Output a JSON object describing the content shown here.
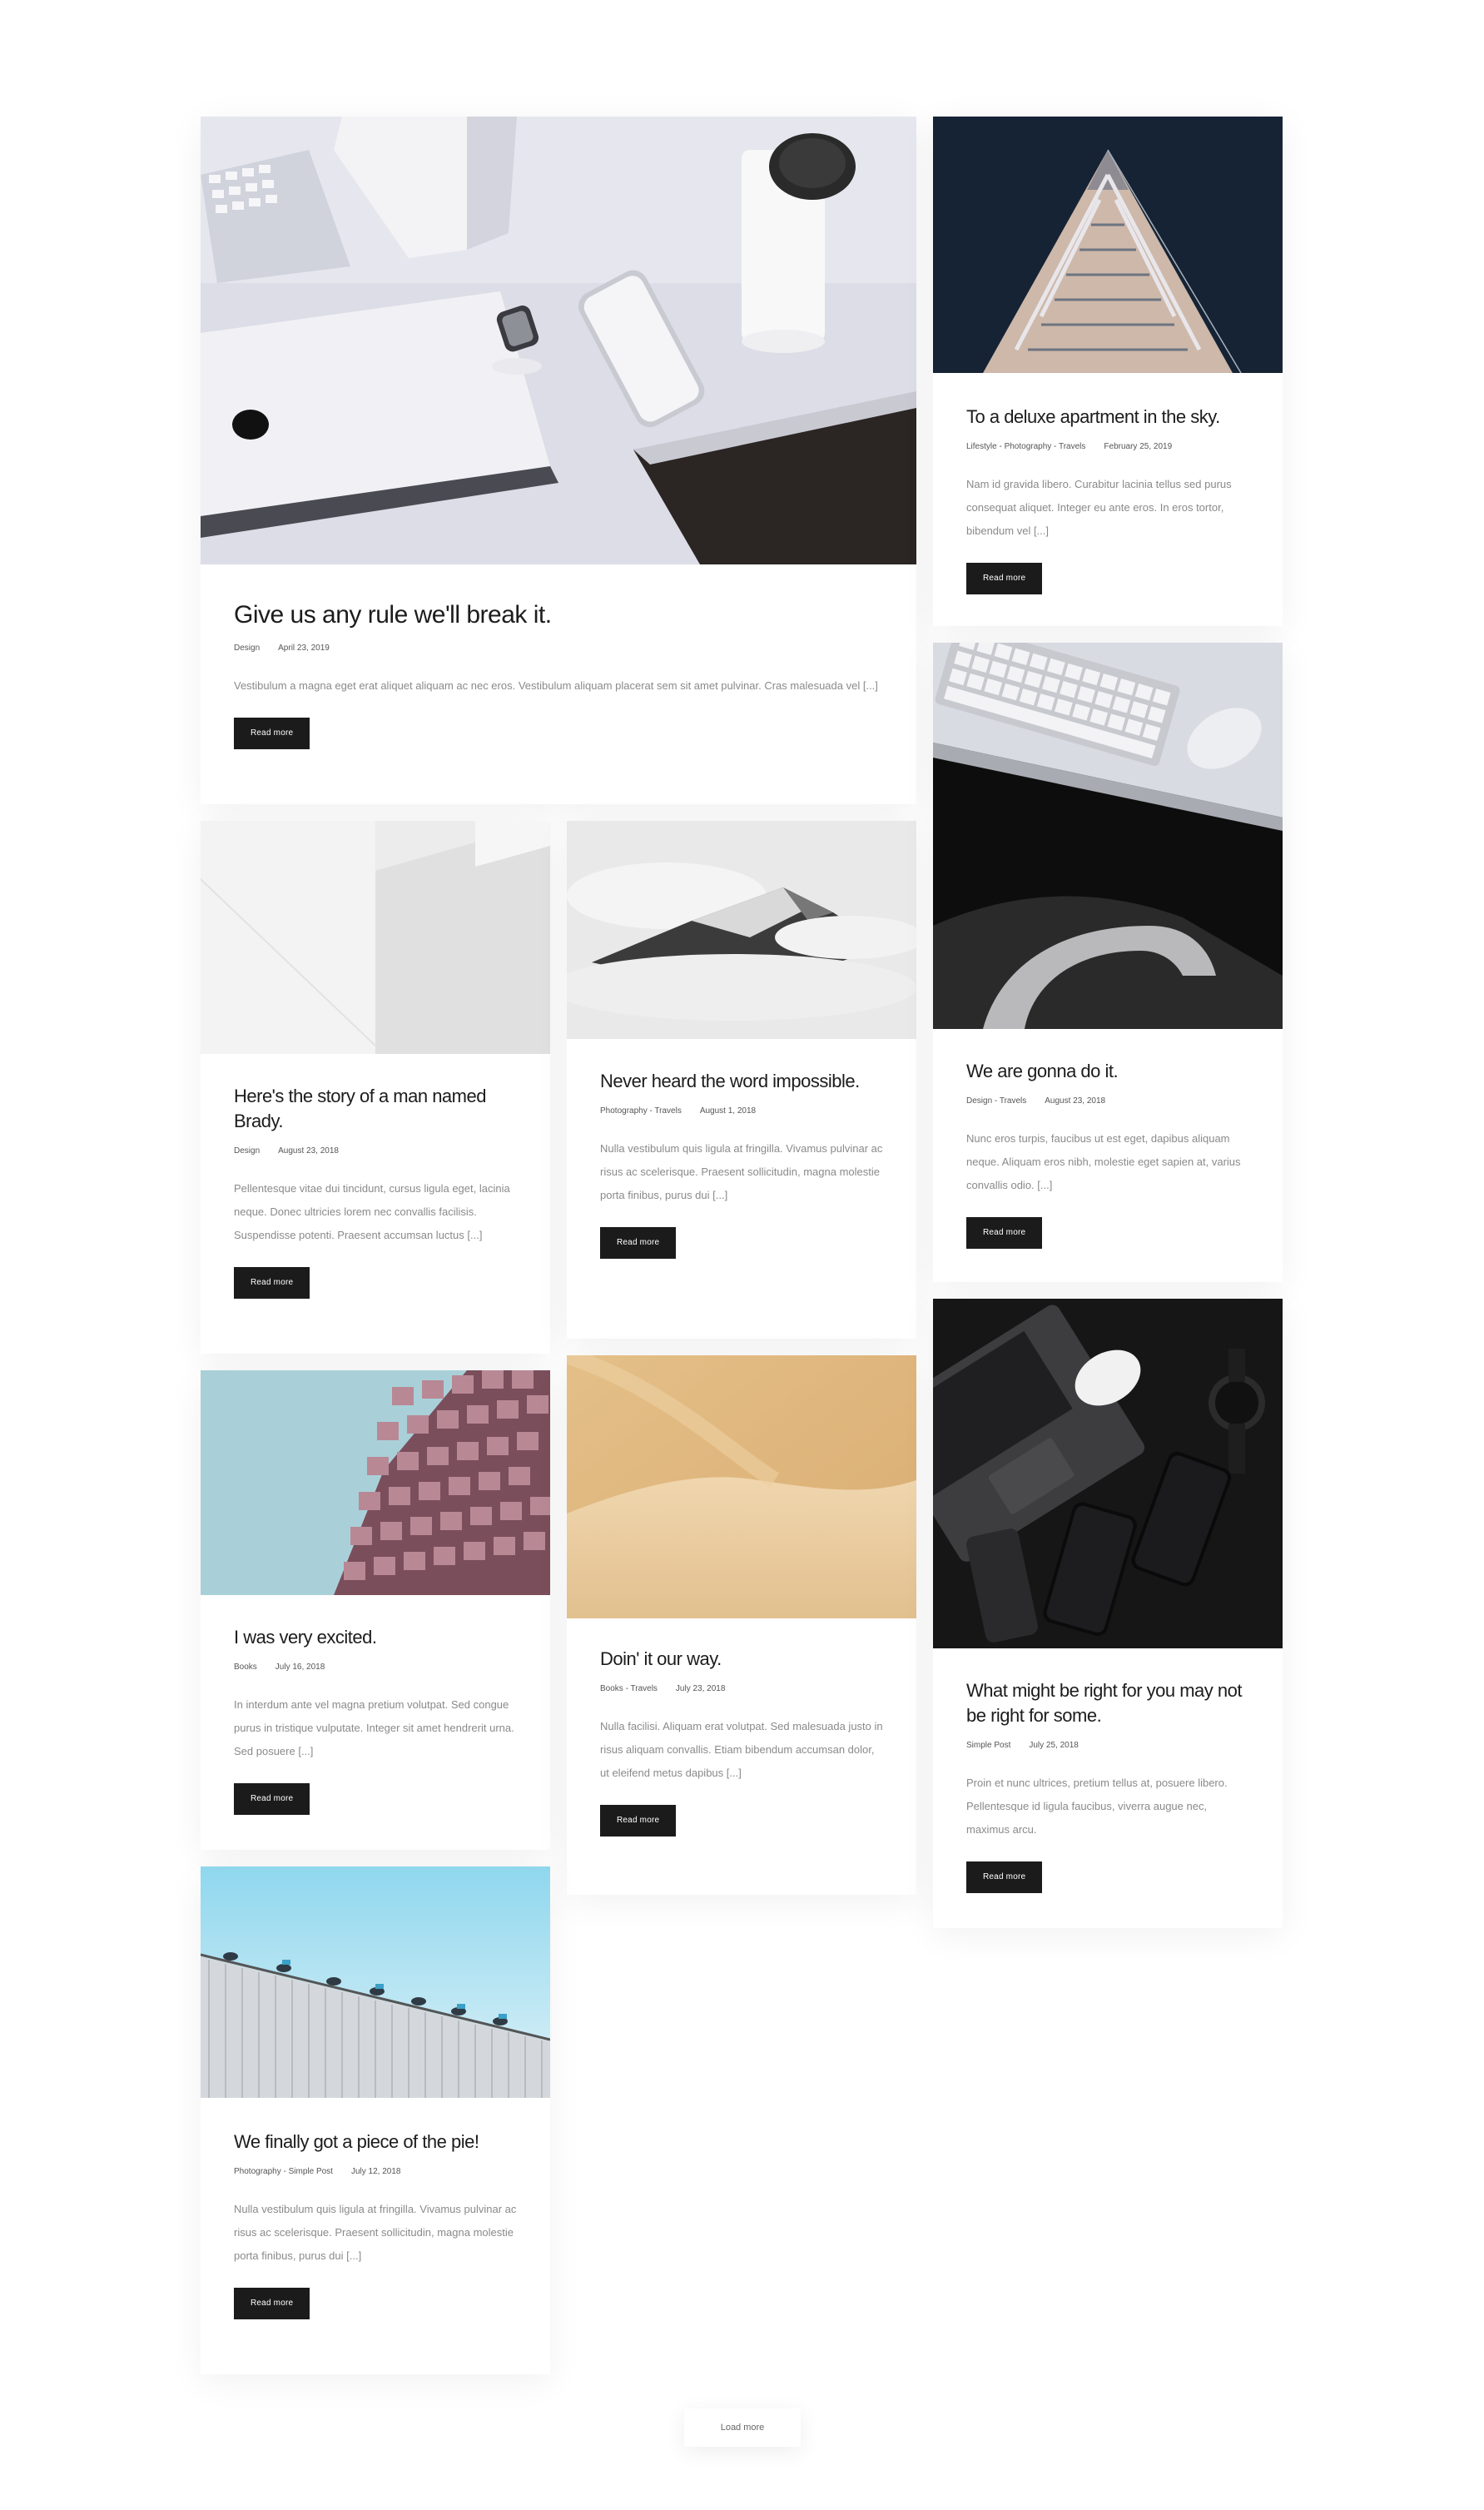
{
  "posts": [
    {
      "title": "Give us any rule we'll break it.",
      "categories": "Design",
      "date": "April 23, 2019",
      "excerpt": "Vestibulum a magna eget erat aliquet aliquam ac nec eros. Vestibulum aliquam placerat sem sit amet pulvinar. Cras malesuada vel [...]",
      "button": "Read more",
      "image": "desk-with-phone-watch-coffee"
    },
    {
      "title": "To a deluxe apartment in the sky.",
      "categories": "Lifestyle - Photography - Travels",
      "date": "February 25, 2019",
      "excerpt": "Nam id gravida libero. Curabitur lacinia tellus sed purus consequat aliquet. Integer eu ante eros. In eros tortor, bibendum vel [...]",
      "button": "Read more",
      "image": "skyscraper-corner-night"
    },
    {
      "title": "Here's the story of a man named Brady.",
      "categories": "Design",
      "date": "August 23, 2018",
      "excerpt": "Pellentesque vitae dui tincidunt, cursus ligula eget, lacinia neque. Donec ultricies lorem nec convallis facilisis. Suspendisse potenti. Praesent accumsan luctus [...]",
      "button": "Read more",
      "image": "white-architecture"
    },
    {
      "title": "Never heard the word impossible.",
      "categories": "Photography - Travels",
      "date": "August 1, 2018",
      "excerpt": "Nulla vestibulum quis ligula at fringilla. Vivamus pulvinar ac risus ac scelerisque. Praesent sollicitudin, magna molestie porta finibus, purus dui [...]",
      "button": "Read more",
      "image": "misty-mountain"
    },
    {
      "title": "We are gonna do it.",
      "categories": "Design - Travels",
      "date": "August 23, 2018",
      "excerpt": "Nunc eros turpis, faucibus ut est eget, dapibus aliquam neque. Aliquam eros nibh, molestie eget sapien at, varius convallis odio. [...]",
      "button": "Read more",
      "image": "keyboard-mouse-desk"
    },
    {
      "title": "I was very excited.",
      "categories": "Books",
      "date": "July 16, 2018",
      "excerpt": "In interdum ante vel magna pretium volutpat. Sed congue purus in tristique vulputate. Integer sit amet hendrerit urna. Sed posuere [...]",
      "button": "Read more",
      "image": "pink-building-facade"
    },
    {
      "title": "Doin' it our way.",
      "categories": "Books - Travels",
      "date": "July 23, 2018",
      "excerpt": "Nulla facilisi. Aliquam erat volutpat. Sed malesuada justo in risus aliquam convallis. Etiam bibendum accumsan dolor, ut eleifend metus dapibus [...]",
      "button": "Read more",
      "image": "sand-dune"
    },
    {
      "title": "What might be right for you may not be right for some.",
      "categories": "Simple Post",
      "date": "July 25, 2018",
      "excerpt": "Proin et nunc ultrices, pretium tellus at, posuere libero. Pellentesque id ligula faucibus, viverra augue nec, maximus arcu.",
      "button": "Read more",
      "image": "dark-desk-laptop-phones"
    },
    {
      "title": "We finally got a piece of the pie!",
      "categories": "Photography - Simple Post",
      "date": "July 12, 2018",
      "excerpt": "Nulla vestibulum quis ligula at fringilla. Vivamus pulvinar ac risus ac scelerisque. Praesent sollicitudin, magna molestie porta finibus, purus dui [...]",
      "button": "Read more",
      "image": "birds-on-metal-roof"
    }
  ],
  "load_more": "Load more",
  "colors": {
    "button_bg": "#1b1b1b",
    "excerpt": "#8a8a8a",
    "background": "#ffffff"
  }
}
